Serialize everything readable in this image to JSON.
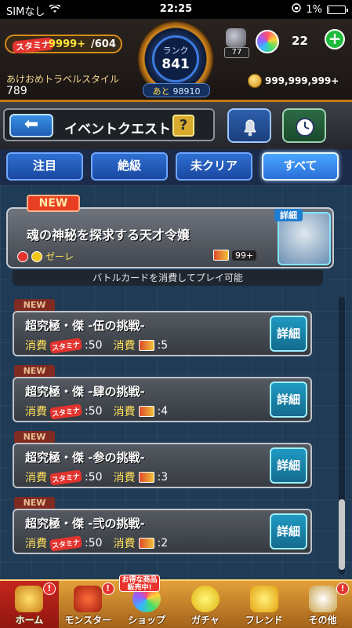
{
  "status_bar": {
    "carrier": "SIMなし",
    "time": "22:25",
    "battery": "1%"
  },
  "header": {
    "stamina_tag": "スタミナ",
    "stamina_value": "9999+",
    "stamina_max": "/604",
    "player_name": "あけおめトラベルスタイル",
    "player_id": "789",
    "rank_label": "ランク",
    "rank_value": "841",
    "next_label": "あと",
    "next_value": "98910",
    "bell_count": "77",
    "orb_count": "22",
    "coin_count": "999,999,999+"
  },
  "titlebar": {
    "title": "イベントクエスト",
    "help": "?"
  },
  "filters": [
    {
      "label": "注目",
      "active": false
    },
    {
      "label": "絶級",
      "active": false
    },
    {
      "label": "未クリア",
      "active": false
    },
    {
      "label": "すべて",
      "active": true
    }
  ],
  "featured": {
    "badge": "NEW",
    "name": "魂の神秘を探求する天才令嬢",
    "attribute": "ゼーレ",
    "card_count": "99+",
    "detail": "詳細",
    "note": "バトルカードを消費してプレイ可能"
  },
  "quests": [
    {
      "badge": "NEW",
      "name": "超究極・傑 -伍の挑戦-",
      "cost_label": "消費",
      "stamina": "スタミナ",
      "stamina_cost": ":50",
      "card_label": "消費",
      "card_cost": ":5",
      "detail": "詳細"
    },
    {
      "badge": "NEW",
      "name": "超究極・傑 -肆の挑戦-",
      "cost_label": "消費",
      "stamina": "スタミナ",
      "stamina_cost": ":50",
      "card_label": "消費",
      "card_cost": ":4",
      "detail": "詳細"
    },
    {
      "badge": "NEW",
      "name": "超究極・傑 -参の挑戦-",
      "cost_label": "消費",
      "stamina": "スタミナ",
      "stamina_cost": ":50",
      "card_label": "消費",
      "card_cost": ":3",
      "detail": "詳細"
    },
    {
      "badge": "NEW",
      "name": "超究極・傑 -弐の挑戦-",
      "cost_label": "消費",
      "stamina": "スタミナ",
      "stamina_cost": ":50",
      "card_label": "消費",
      "card_cost": ":2",
      "detail": "詳細"
    }
  ],
  "bottom_nav": {
    "promo": "お得な商品販売中!",
    "items": [
      {
        "label": "ホーム",
        "icon": "home-icon",
        "alert": "!"
      },
      {
        "label": "モンスター",
        "icon": "monster-icon",
        "alert": "!"
      },
      {
        "label": "ショップ",
        "icon": "shop-icon",
        "alert": ""
      },
      {
        "label": "ガチャ",
        "icon": "gacha-icon",
        "alert": ""
      },
      {
        "label": "フレンド",
        "icon": "friend-icon",
        "alert": ""
      },
      {
        "label": "その他",
        "icon": "other-icon",
        "alert": "!"
      }
    ]
  },
  "colors": {
    "accent": "#d58b1b",
    "filter_active": "#4aa6ff",
    "detail_button": "#1e9ac2"
  }
}
